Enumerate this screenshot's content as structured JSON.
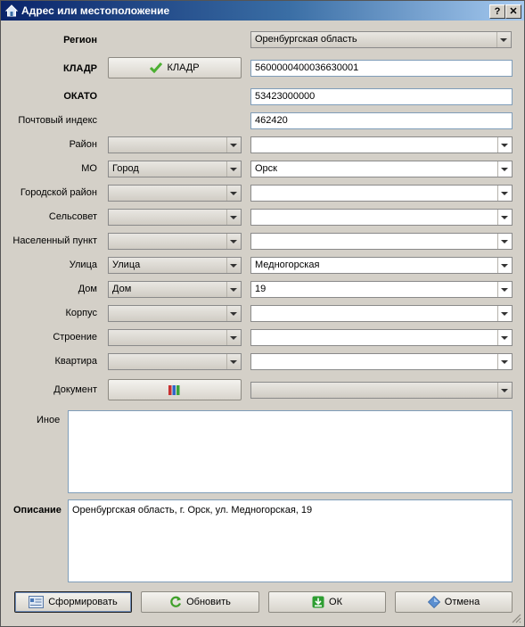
{
  "window": {
    "title": "Адрес или местоположение",
    "help_button": "?",
    "close_button": "✕"
  },
  "region": {
    "label": "Регион",
    "value": "Оренбургская область"
  },
  "kladr": {
    "label": "КЛАДР",
    "button_label": "КЛАДР",
    "value": "5600000400036630001"
  },
  "okato": {
    "label": "ОКАТО",
    "value": "53423000000"
  },
  "postal": {
    "label": "Почтовый индекс",
    "value": "462420"
  },
  "rows": [
    {
      "label": "Район",
      "type": "",
      "value": ""
    },
    {
      "label": "МО",
      "type": "Город",
      "value": "Орск"
    },
    {
      "label": "Городской район",
      "type": "",
      "value": ""
    },
    {
      "label": "Сельсовет",
      "type": "",
      "value": ""
    },
    {
      "label": "Населенный пункт",
      "type": "",
      "value": ""
    },
    {
      "label": "Улица",
      "type": "Улица",
      "value": "Медногорская"
    },
    {
      "label": "Дом",
      "type": "Дом",
      "value": "19"
    },
    {
      "label": "Корпус",
      "type": "",
      "value": ""
    },
    {
      "label": "Строение",
      "type": "",
      "value": ""
    },
    {
      "label": "Квартира",
      "type": "",
      "value": ""
    }
  ],
  "document": {
    "label": "Документ",
    "value": ""
  },
  "other": {
    "label": "Иное",
    "value": ""
  },
  "description": {
    "label": "Описание",
    "value": "Оренбургская область, г. Орск, ул. Медногорская, 19"
  },
  "buttons": {
    "form": "Сформировать",
    "refresh": "Обновить",
    "ok": "ОК",
    "cancel": "Отмена"
  },
  "icons": {
    "window": "house-icon",
    "kladr": "checkmark-icon",
    "document": "binders-icon",
    "form": "form-icon",
    "refresh": "refresh-icon",
    "ok": "download-arrow-icon",
    "cancel": "diamond-icon"
  },
  "colors": {
    "title_start": "#0a246a",
    "title_end": "#a6caf0",
    "check": "#4caf32",
    "refresh": "#3fa02a",
    "ok": "#2e9e32",
    "cancel": "#5b8fd0"
  }
}
